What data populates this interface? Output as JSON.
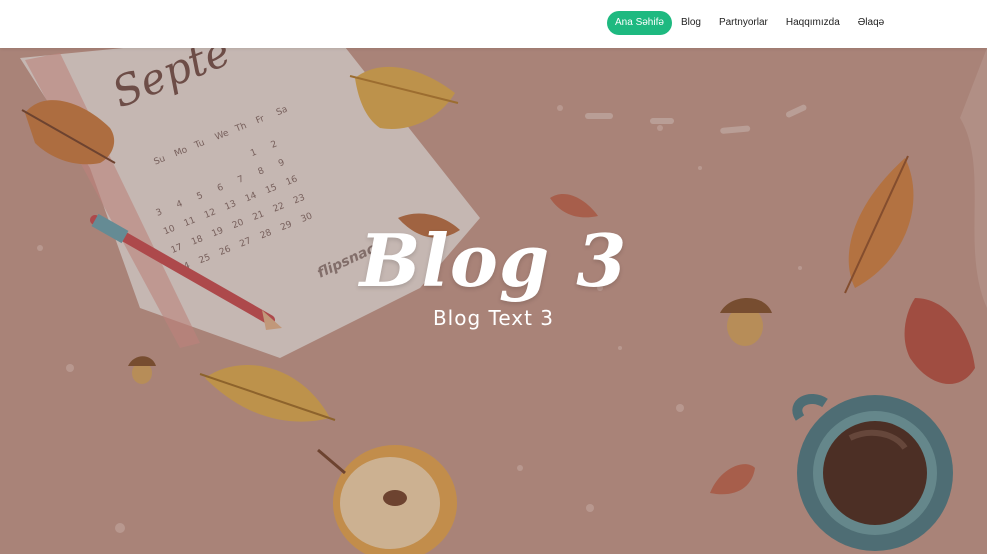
{
  "nav": {
    "items": [
      {
        "label": "Ana Səhifə",
        "active": true
      },
      {
        "label": "Blog",
        "active": false
      },
      {
        "label": "Partnyorlar",
        "active": false
      },
      {
        "label": "Haqqımızda",
        "active": false
      },
      {
        "label": "Əlaqə",
        "active": false
      }
    ]
  },
  "hero": {
    "title": "Blog 3",
    "subtitle": "Blog Text 3",
    "calendar": {
      "month_partial": "Septe",
      "weekdays": [
        "Su",
        "Mo",
        "Tu",
        "We",
        "Th",
        "Fr",
        "Sa"
      ],
      "days": [
        "1",
        "2",
        "3",
        "4",
        "5",
        "6",
        "7",
        "8",
        "9",
        "10",
        "11",
        "12",
        "13",
        "14",
        "15",
        "16",
        "17",
        "18",
        "19",
        "20",
        "21",
        "22",
        "23",
        "24",
        "25",
        "26",
        "27",
        "28",
        "29",
        "30"
      ],
      "watermark": "flipsnack"
    }
  },
  "colors": {
    "accent": "#1eb980",
    "hero_bg": "#c39a8d"
  }
}
